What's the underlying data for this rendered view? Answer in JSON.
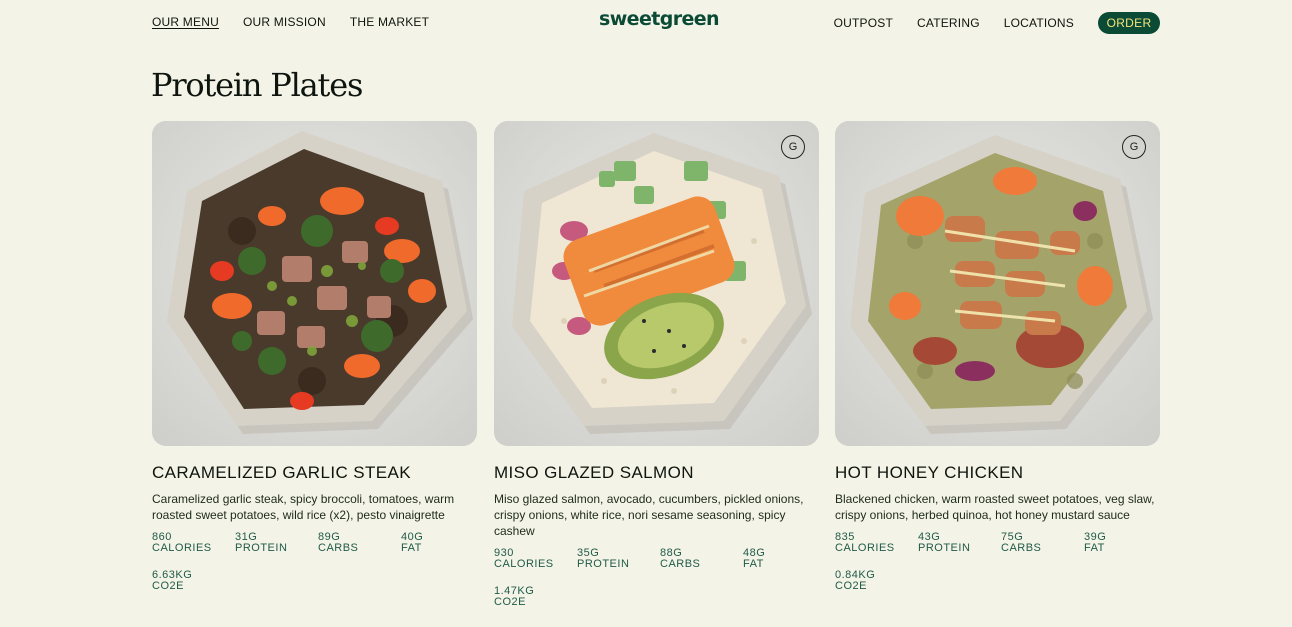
{
  "nav": {
    "left": [
      "OUR MENU",
      "OUR MISSION",
      "THE MARKET"
    ],
    "logo": "sweetgreen",
    "right": [
      "OUTPOST",
      "CATERING",
      "LOCATIONS"
    ],
    "order": "ORDER"
  },
  "page": {
    "title": "Protein Plates"
  },
  "colors": {
    "background": "#f4f3e7",
    "brand_green": "#0b4a35",
    "order_text": "#f3e37a",
    "stat_text": "#1f5a47"
  },
  "cards": [
    {
      "title": "CARAMELIZED GARLIC STEAK",
      "description": "Caramelized garlic steak, spicy broccoli, tomatoes, warm roasted sweet potatoes, wild rice (x2), pesto vinaigrette",
      "badge": "",
      "image_icon": "steak-bowl-image",
      "stats": [
        {
          "value": "860",
          "label": "CALORIES"
        },
        {
          "value": "31G",
          "label": "PROTEIN"
        },
        {
          "value": "89G",
          "label": "CARBS"
        },
        {
          "value": "40G",
          "label": "FAT"
        },
        {
          "value": "6.63KG",
          "label": "CO2E"
        }
      ]
    },
    {
      "title": "MISO GLAZED SALMON",
      "description": "Miso glazed salmon, avocado, cucumbers, pickled onions, crispy onions, white rice, nori sesame seasoning, spicy cashew",
      "badge": "G",
      "image_icon": "salmon-bowl-image",
      "stats": [
        {
          "value": "930",
          "label": "CALORIES"
        },
        {
          "value": "35G",
          "label": "PROTEIN"
        },
        {
          "value": "88G",
          "label": "CARBS"
        },
        {
          "value": "48G",
          "label": "FAT"
        },
        {
          "value": "1.47KG",
          "label": "CO2E"
        }
      ]
    },
    {
      "title": "HOT HONEY CHICKEN",
      "description": "Blackened chicken, warm roasted sweet potatoes, veg slaw, crispy onions, herbed quinoa, hot honey mustard sauce",
      "badge": "G",
      "image_icon": "chicken-bowl-image",
      "stats": [
        {
          "value": "835",
          "label": "CALORIES"
        },
        {
          "value": "43G",
          "label": "PROTEIN"
        },
        {
          "value": "75G",
          "label": "CARBS"
        },
        {
          "value": "39G",
          "label": "FAT"
        },
        {
          "value": "0.84KG",
          "label": "CO2E"
        }
      ]
    }
  ]
}
